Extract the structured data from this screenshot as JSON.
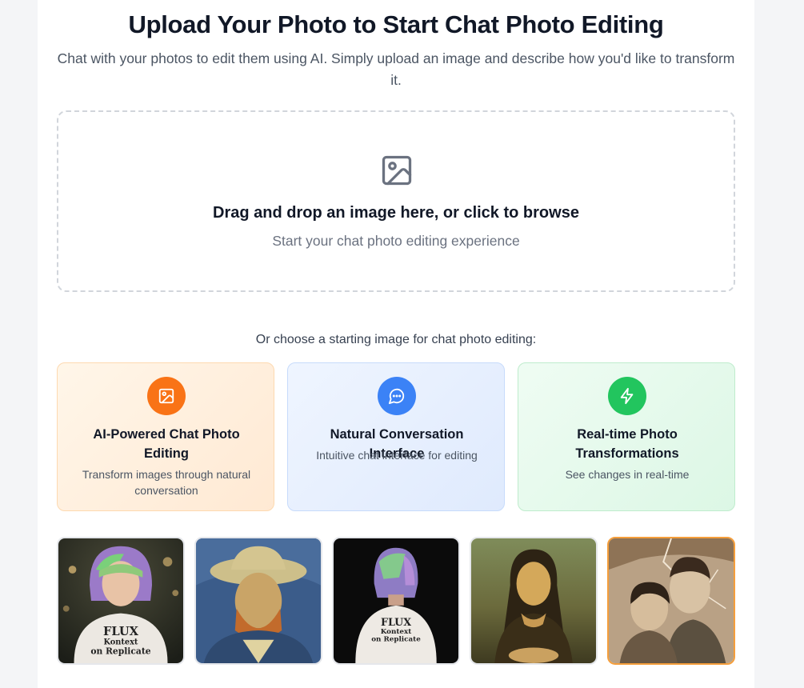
{
  "header": {
    "title": "Upload Your Photo to Start Chat Photo Editing",
    "subtitle": "Chat with your photos to edit them using AI. Simply upload an image and describe how you'd like to transform it."
  },
  "dropzone": {
    "title": "Drag and drop an image here, or click to browse",
    "subtitle": "Start your chat photo editing experience",
    "icon": "image-icon"
  },
  "starters": {
    "prompt": "Or choose a starting image for chat photo editing:"
  },
  "features": [
    {
      "title": "AI-Powered Chat Photo Editing",
      "desc": "Transform images through natural conversation",
      "icon": "image-icon",
      "color": "#f97316"
    },
    {
      "title": "Natural Conversation Interface",
      "desc": "Intuitive chat interface for editing",
      "icon": "chat-bubble-icon",
      "color": "#3b82f6"
    },
    {
      "title": "Real-time Photo Transformations",
      "desc": "See changes in real-time",
      "icon": "lightning-icon",
      "color": "#22c55e"
    }
  ],
  "thumbnails": [
    {
      "name": "woman-flux-shirt",
      "shirt_text": [
        "FLUX",
        "Kontext",
        "on Replicate"
      ]
    },
    {
      "name": "van-gogh-portrait"
    },
    {
      "name": "woman-back-flux-shirt",
      "shirt_text": [
        "FLUX",
        "Kontext",
        "on Replicate"
      ]
    },
    {
      "name": "mona-lisa"
    },
    {
      "name": "vintage-couple-photo",
      "selected": true
    }
  ]
}
